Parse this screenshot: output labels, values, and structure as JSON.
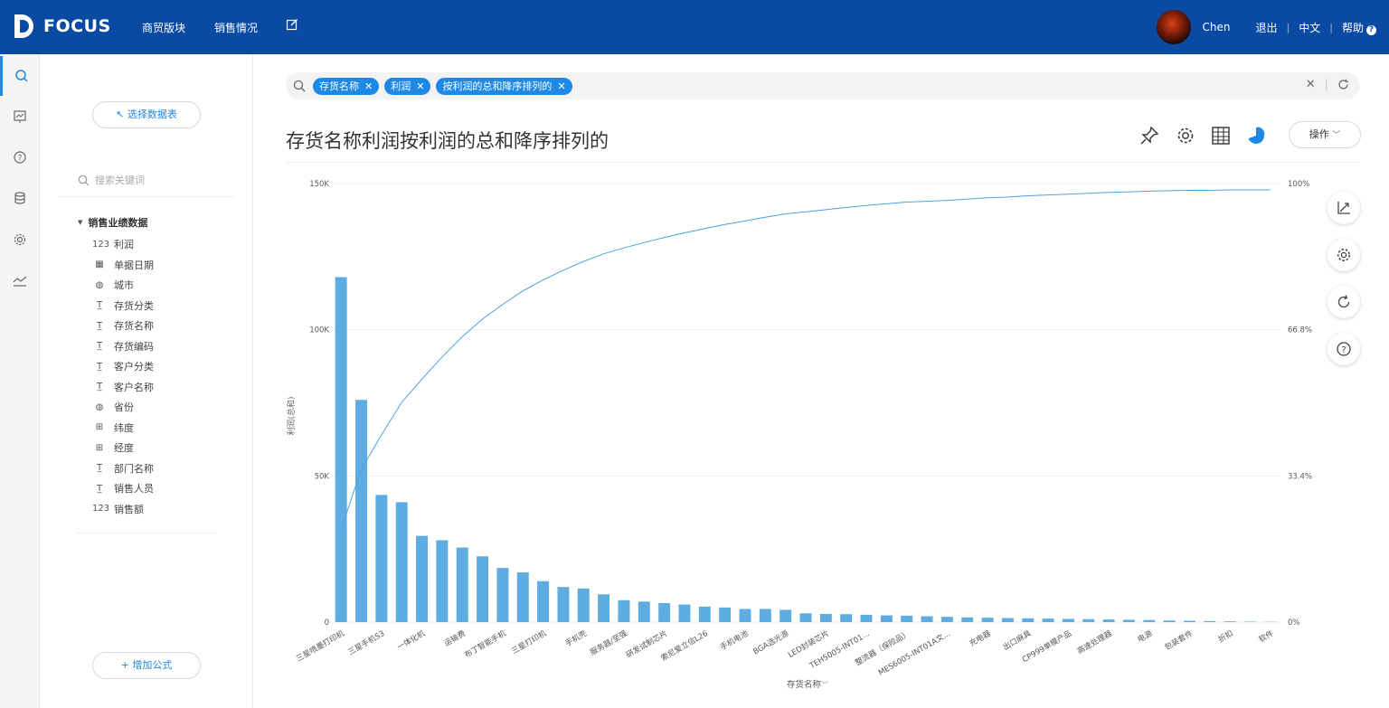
{
  "header": {
    "logo_text": "FOCUS",
    "nav": [
      "商贸版块",
      "销售情况"
    ],
    "user_name": "Chen",
    "logout": "退出",
    "language": "中文",
    "help": "帮助"
  },
  "sidebar": {
    "select_table_button": "↖ 选择数据表",
    "search_placeholder": "搜索关键词",
    "group_title": "销售业绩数据",
    "items": [
      {
        "label": "利润",
        "icon": "number-icon"
      },
      {
        "label": "单据日期",
        "icon": "calendar-icon"
      },
      {
        "label": "城市",
        "icon": "globe-icon"
      },
      {
        "label": "存货分类",
        "icon": "text-type-icon"
      },
      {
        "label": "存货名称",
        "icon": "text-type-icon"
      },
      {
        "label": "存货编码",
        "icon": "text-type-icon"
      },
      {
        "label": "客户分类",
        "icon": "text-type-icon"
      },
      {
        "label": "客户名称",
        "icon": "text-type-icon"
      },
      {
        "label": "省份",
        "icon": "globe-icon"
      },
      {
        "label": "纬度",
        "icon": "map-icon"
      },
      {
        "label": "经度",
        "icon": "map-icon"
      },
      {
        "label": "部门名称",
        "icon": "text-type-icon"
      },
      {
        "label": "销售人员",
        "icon": "text-type-icon"
      },
      {
        "label": "销售额",
        "icon": "number-icon"
      }
    ],
    "add_formula_button": "+ 增加公式"
  },
  "search": {
    "chips": [
      "存货名称",
      "利润",
      "按利润的总和降序排列的"
    ]
  },
  "main": {
    "title": "存货名称利润按利润的总和降序排列的",
    "operations_button": "操作"
  },
  "colors": {
    "header_bg": "#0b4aa2",
    "accent": "#1e88e5",
    "bar": "#5dade2",
    "line": "#4aa3df"
  },
  "chart_data": {
    "type": "bar",
    "title": "",
    "xlabel": "存货名称",
    "ylabel": "利润(总和)",
    "ylim": [
      0,
      150000
    ],
    "y_ticks": [
      "0",
      "50K",
      "100K",
      "150K"
    ],
    "y2_ticks": [
      "0%",
      "33.4%",
      "66.8%",
      "100%"
    ],
    "x_tick_labels": [
      "三星喷墨打印机",
      "三星手机S3",
      "一体化机",
      "运输费",
      "布丁智能手机",
      "三星打印机",
      "手机壳",
      "服务器/至强",
      "研发试制芯片",
      "索尼爱立信L26",
      "手机电池",
      "BGA选光源",
      "LED封装芯片",
      "TEH5005-INT01...",
      "整流器（保险品）",
      "MES6005-INT01A文...",
      "充电器",
      "出口麻具",
      "CP999单模产品",
      "高速处理器",
      "电源",
      "包装套件",
      "折扣",
      "软件"
    ],
    "values": [
      118000,
      76000,
      43500,
      41000,
      29500,
      28000,
      25500,
      22500,
      18500,
      17000,
      14000,
      12000,
      11500,
      9500,
      7500,
      7000,
      6500,
      6000,
      5300,
      5000,
      4500,
      4500,
      4200,
      3000,
      2800,
      2700,
      2500,
      2300,
      2200,
      2000,
      1800,
      1600,
      1500,
      1400,
      1300,
      1200,
      1100,
      1000,
      900,
      800,
      700,
      550,
      450,
      350,
      250,
      150,
      100
    ],
    "cumulative_percent": [
      22,
      36.3,
      44.5,
      52.2,
      57.7,
      63,
      67.8,
      72,
      75.5,
      78.7,
      81.3,
      83.6,
      85.7,
      87.5,
      88.9,
      90.2,
      91.4,
      92.5,
      93.5,
      94.5,
      95.3,
      96.2,
      97,
      97.5,
      98,
      98.5,
      99,
      99.4,
      99.8,
      100,
      100.2,
      100.5,
      100.8,
      101,
      101.3,
      101.5,
      101.7,
      101.9,
      102.1,
      102.2,
      102.4,
      102.5,
      102.6,
      102.6,
      102.7,
      102.7,
      102.7
    ],
    "legend": "none",
    "grid": true
  }
}
